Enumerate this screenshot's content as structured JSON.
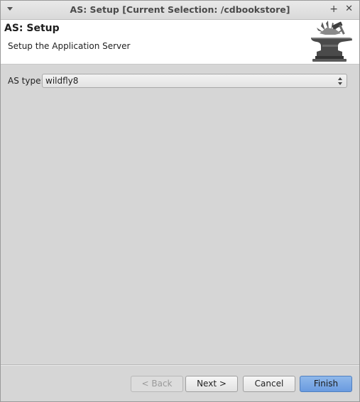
{
  "window": {
    "title": "AS: Setup [Current Selection: /cdbookstore]",
    "maximize_glyph": "+",
    "close_glyph": "✕"
  },
  "header": {
    "title": "AS: Setup",
    "description": "Setup the Application Server",
    "banner_icon": "anvil-icon"
  },
  "form": {
    "as_type_label": "AS type:",
    "as_type_value": "wildfly8"
  },
  "buttons": {
    "back": "< Back",
    "next": "Next >",
    "cancel": "Cancel",
    "finish": "Finish"
  },
  "colors": {
    "finish_accent": "#6a9be0",
    "background": "#d6d6d6"
  }
}
